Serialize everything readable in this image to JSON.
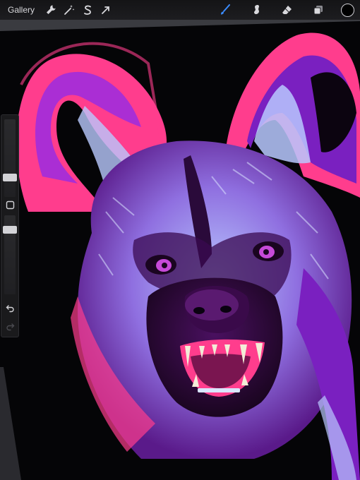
{
  "toolbar": {
    "gallery_label": "Gallery",
    "left_tools": [
      {
        "name": "actions",
        "icon": "wrench-icon"
      },
      {
        "name": "adjustments",
        "icon": "magic-wand-icon"
      },
      {
        "name": "selection",
        "icon": "selection-s-icon"
      },
      {
        "name": "transform",
        "icon": "arrow-cursor-icon"
      }
    ],
    "right_tools": [
      {
        "name": "brush",
        "icon": "brush-icon",
        "active": true
      },
      {
        "name": "smudge",
        "icon": "smudge-icon",
        "active": false
      },
      {
        "name": "eraser",
        "icon": "eraser-icon",
        "active": false
      },
      {
        "name": "layers",
        "icon": "layers-icon",
        "active": false
      }
    ],
    "current_color": "#000000",
    "accent_color": "#3b8cff"
  },
  "sidebar": {
    "brush_size_level": 0.22,
    "opacity_level": 0.85,
    "modify_button_icon": "square-icon",
    "undo_icon": "undo-icon",
    "redo_icon": "redo-icon",
    "redo_enabled": false
  },
  "artwork": {
    "subject": "african-wild-dog-snarling",
    "palette": [
      "#ff3d8d",
      "#9b2be0",
      "#b9c9ff",
      "#5a1a8a",
      "#000000"
    ]
  }
}
